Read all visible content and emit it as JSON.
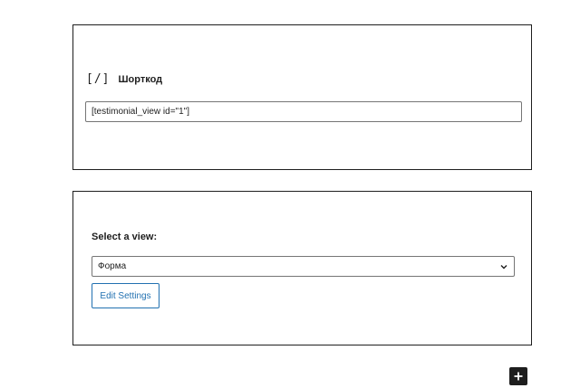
{
  "shortcode_block": {
    "icon_glyph": "[/]",
    "icon": "shortcode-icon",
    "title": "Шорткод",
    "value": "[testimonial_view id=\"1\"]"
  },
  "view_block": {
    "label": "Select a view:",
    "selected_option": "Форма",
    "edit_button_label": "Edit Settings",
    "accent_color": "#2271b1"
  },
  "inserter": {
    "icon": "plus-icon"
  }
}
